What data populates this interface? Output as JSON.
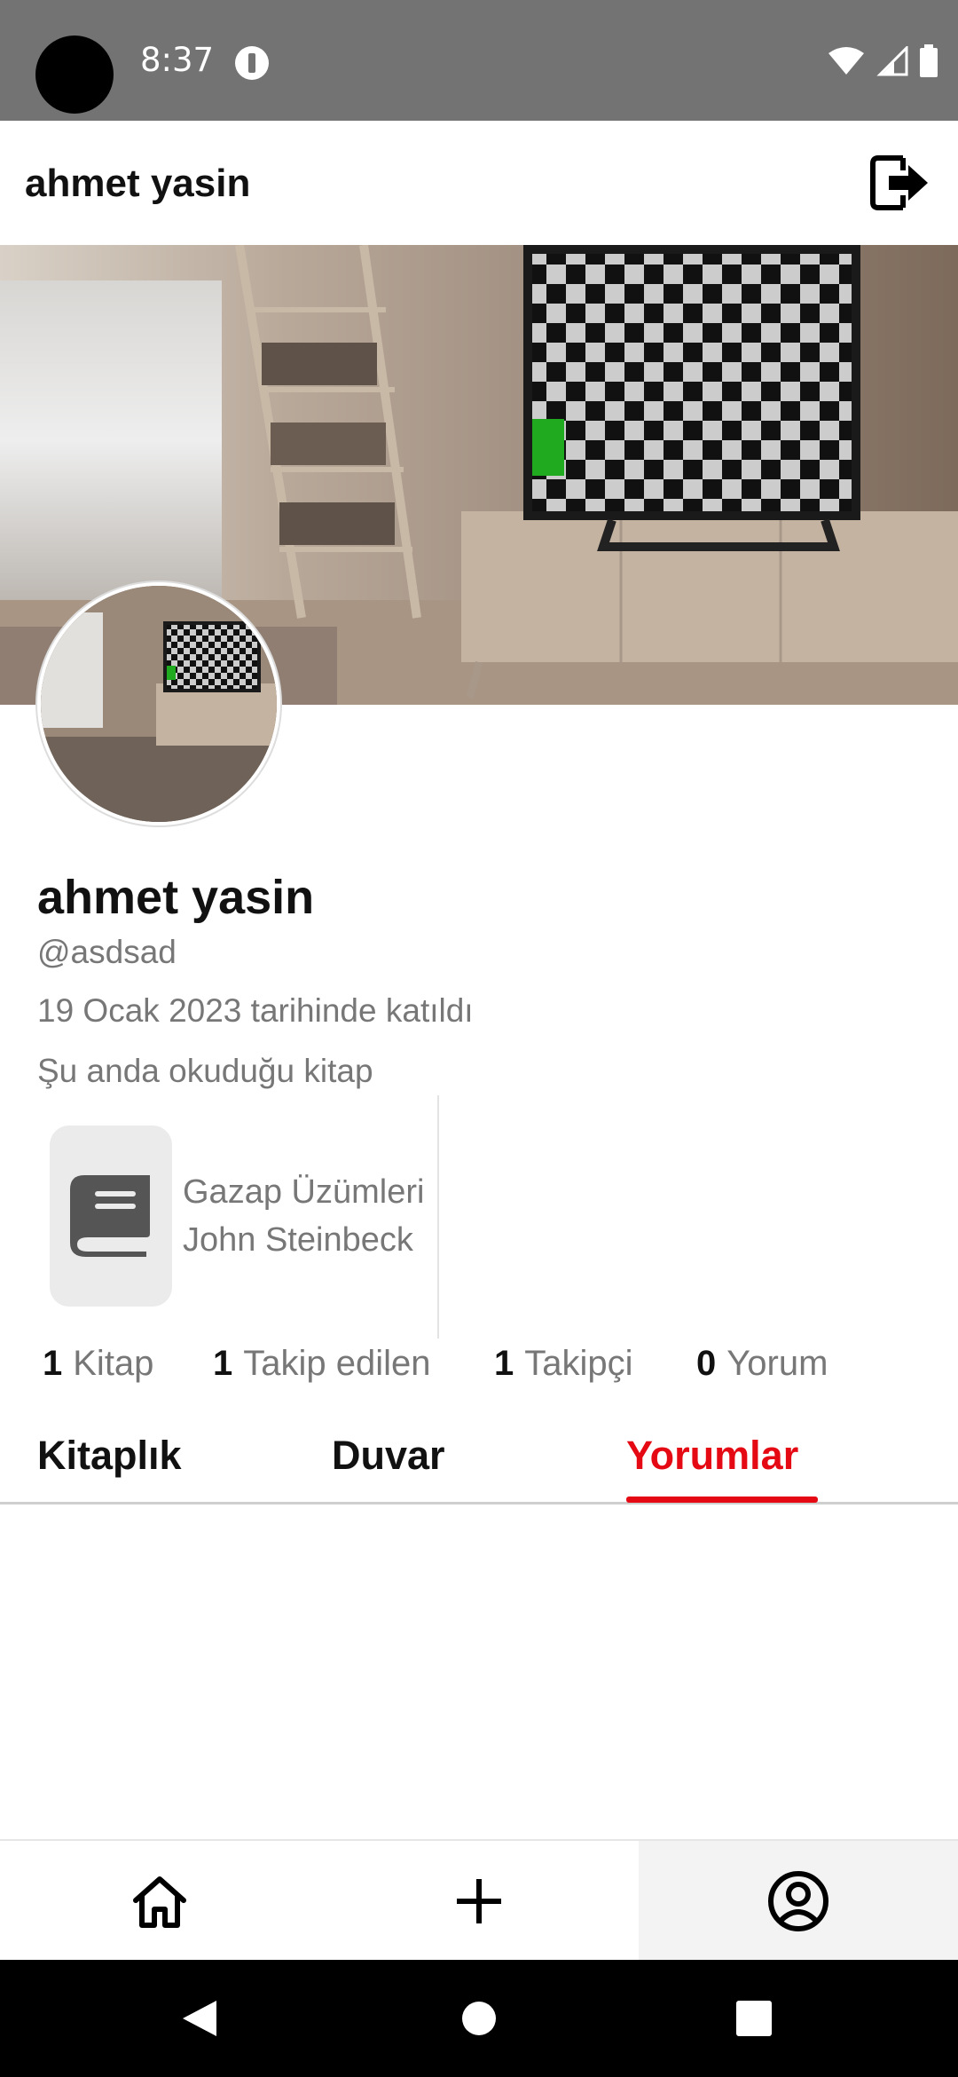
{
  "status_bar": {
    "time": "8:37"
  },
  "header": {
    "title": "ahmet yasin"
  },
  "profile": {
    "name": "ahmet yasin",
    "handle": "@asdsad",
    "joined": "19 Ocak 2023 tarihinde katıldı",
    "reading_label": "Şu anda okuduğu kitap"
  },
  "current_book": {
    "title": "Gazap Üzümleri",
    "author": "John Steinbeck"
  },
  "stats": [
    {
      "count": "1",
      "label": "Kitap"
    },
    {
      "count": "1",
      "label": "Takip edilen"
    },
    {
      "count": "1",
      "label": "Takipçi"
    },
    {
      "count": "0",
      "label": "Yorum"
    }
  ],
  "tabs": [
    {
      "label": "Kitaplık",
      "active": false
    },
    {
      "label": "Duvar",
      "active": false
    },
    {
      "label": "Yorumlar",
      "active": true
    }
  ],
  "colors": {
    "accent": "#e50914",
    "status_bar": "#737373"
  },
  "bottom_nav": [
    {
      "icon": "home-icon",
      "active": false
    },
    {
      "icon": "plus-icon",
      "active": false
    },
    {
      "icon": "account-circle-icon",
      "active": true
    }
  ]
}
